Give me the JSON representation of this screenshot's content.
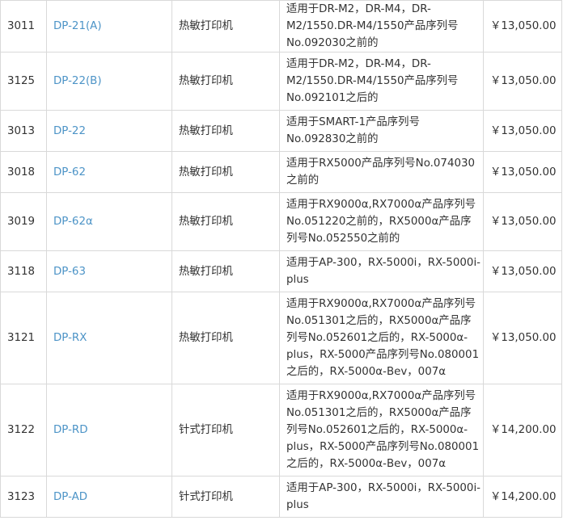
{
  "rows": [
    {
      "code": "3011",
      "model": "DP-21(A)",
      "type": "热敏打印机",
      "desc_lines": [
        "适用于DR-M2，DR-M4，DR-",
        "M2/1550.DR-M4/1550产品序列号",
        "No.092030之前的"
      ],
      "price": "￥13,050.00"
    },
    {
      "code": "3125",
      "model": "DP-22(B)",
      "type": "热敏打印机",
      "desc_lines": [
        "适用于DR-M2，DR-M4，DR-",
        "M2/1550.DR-M4/1550产品序列号",
        "No.092101之后的"
      ],
      "price": "￥13,050.00"
    },
    {
      "code": "3013",
      "model": "DP-22",
      "type": "热敏打印机",
      "desc_lines": [
        "适用于SMART-1产品序列号",
        "No.092830之前的"
      ],
      "price": "￥13,050.00"
    },
    {
      "code": "3018",
      "model": "DP-62",
      "type": "热敏打印机",
      "desc_lines": [
        "适用于RX5000产品序列号No.074030",
        "之前的"
      ],
      "price": "￥13,050.00"
    },
    {
      "code": "3019",
      "model": "DP-62α",
      "type": "热敏打印机",
      "desc_lines": [
        "适用于RX9000α,RX7000α产品序列号",
        "No.051220之前的，RX5000α产品序",
        "列号No.052550之前的"
      ],
      "price": "￥13,050.00"
    },
    {
      "code": "3118",
      "model": "DP-63",
      "type": "热敏打印机",
      "desc_lines": [
        "适用于AP-300，RX-5000i，RX-5000i-",
        "plus"
      ],
      "price": "￥13,050.00"
    },
    {
      "code": "3121",
      "model": "DP-RX",
      "type": "热敏打印机",
      "desc_lines": [
        "适用于RX9000α,RX7000α产品序列号",
        "No.051301之后的，RX5000α产品序",
        "列号No.052601之后的，RX-5000α-",
        "plus，RX-5000产品序列号No.080001",
        "之后的，RX-5000α-Bev，007α"
      ],
      "price": "￥13,050.00"
    },
    {
      "code": "3122",
      "model": "DP-RD",
      "type": "针式打印机",
      "desc_lines": [
        "适用于RX9000α,RX7000α产品序列号",
        "No.051301之后的，RX5000α产品序",
        "列号No.052601之后的，RX-5000α-",
        "plus，RX-5000产品序列号No.080001",
        "之后的，RX-5000α-Bev，007α"
      ],
      "price": "￥14,200.00"
    },
    {
      "code": "3123",
      "model": "DP-AD",
      "type": "针式打印机",
      "desc_lines": [
        "适用于AP-300，RX-5000i，RX-5000i-",
        "plus"
      ],
      "price": "￥14,200.00"
    }
  ],
  "colors": {
    "link": "#4d94c7",
    "text": "#333333",
    "border": "#d9d9d9"
  }
}
